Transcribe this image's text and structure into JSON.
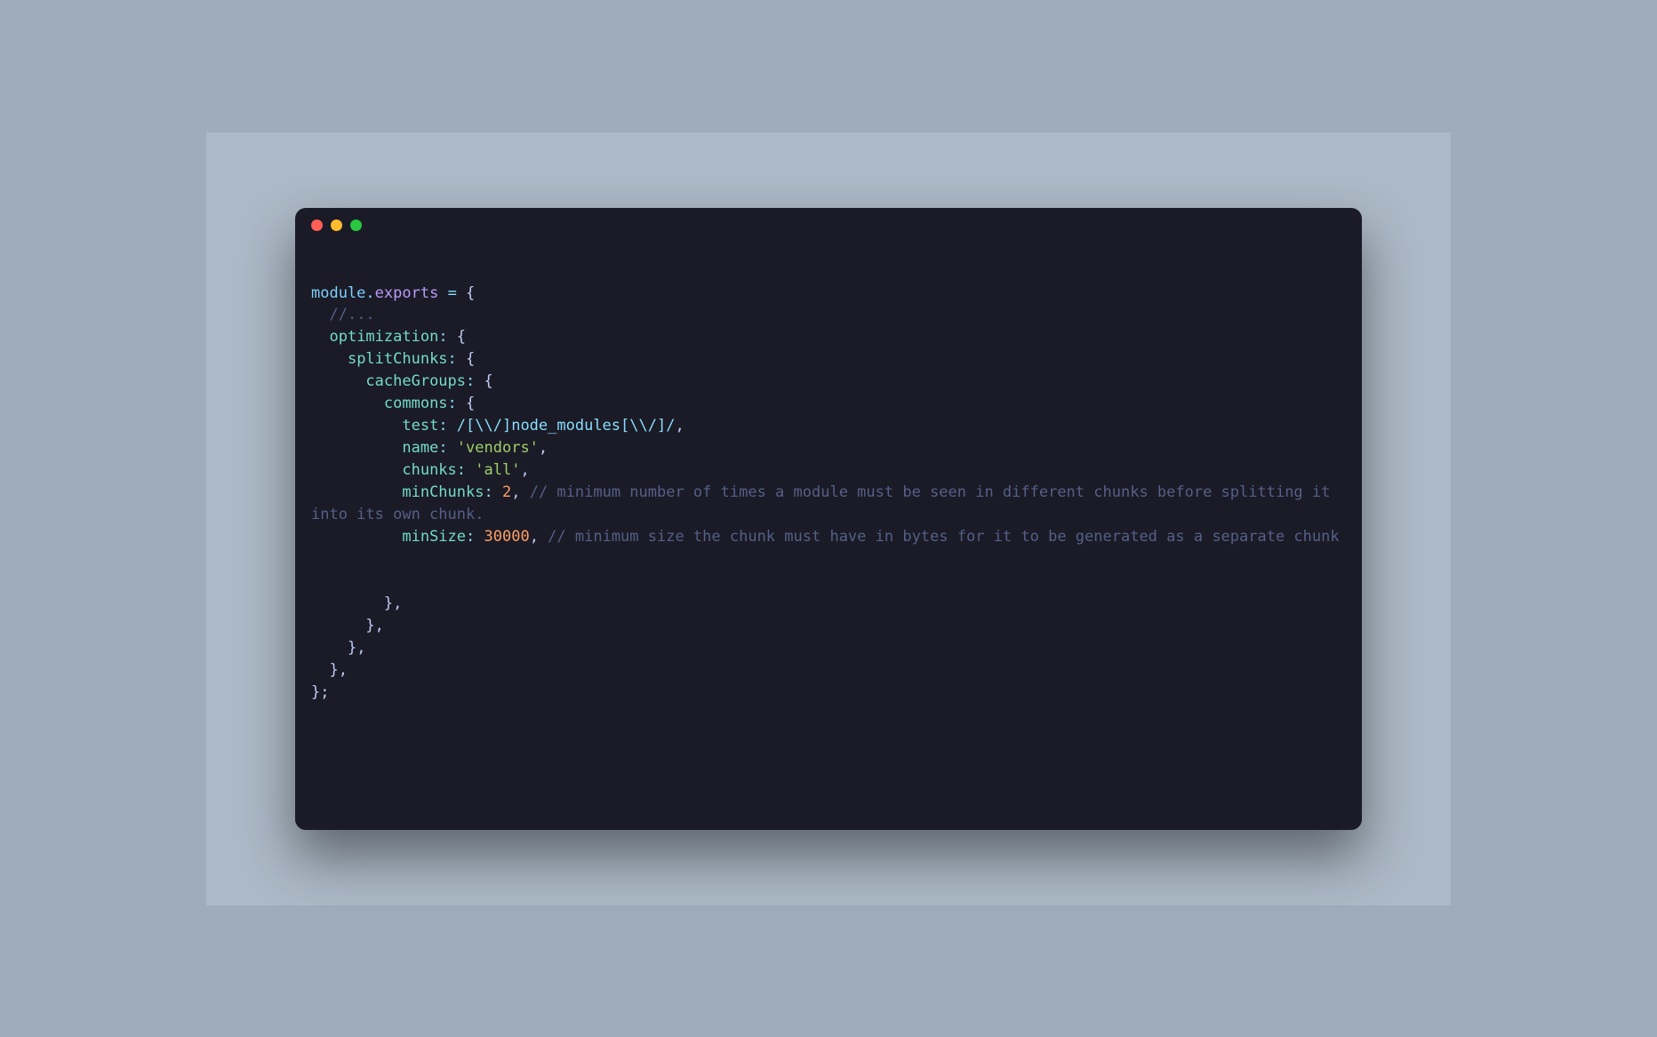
{
  "code": {
    "l1_module": "module",
    "l1_dot": ".",
    "l1_exports": "exports",
    "l1_eq": " = ",
    "l1_brace": "{",
    "l2_comment": "  //...",
    "l3_indent": "  ",
    "l3_key": "optimization",
    "l3_colon": ": ",
    "l3_brace": "{",
    "l4_indent": "    ",
    "l4_key": "splitChunks",
    "l4_colon": ": ",
    "l4_brace": "{",
    "l5_indent": "      ",
    "l5_key": "cacheGroups",
    "l5_colon": ": ",
    "l5_brace": "{",
    "l6_indent": "        ",
    "l6_key": "commons",
    "l6_colon": ": ",
    "l6_brace": "{",
    "l7_indent": "          ",
    "l7_key": "test",
    "l7_colon": ": ",
    "l7_regex": "/[\\\\/]node_modules[\\\\/]/",
    "l7_comma": ",",
    "l8_indent": "          ",
    "l8_key": "name",
    "l8_colon": ": ",
    "l8_str": "'vendors'",
    "l8_comma": ",",
    "l9_indent": "          ",
    "l9_key": "chunks",
    "l9_colon": ": ",
    "l9_str": "'all'",
    "l9_comma": ",",
    "l10_indent": "          ",
    "l10_key": "minChunks",
    "l10_colon": ": ",
    "l10_num": "2",
    "l10_comma": ", ",
    "l10_comment": "// minimum number of times a module must be seen in different chunks before splitting it into its own chunk.",
    "l11_indent": "          ",
    "l11_key": "minSize",
    "l11_colon": ": ",
    "l11_num": "30000",
    "l11_comma": ", ",
    "l11_comment": "// minimum size the chunk must have in bytes for it to be generated as a separate chunk",
    "l12_blank": "",
    "l13_blank": "",
    "l14": "        },",
    "l15": "      },",
    "l16": "    },",
    "l17": "  },",
    "l18": "};"
  }
}
